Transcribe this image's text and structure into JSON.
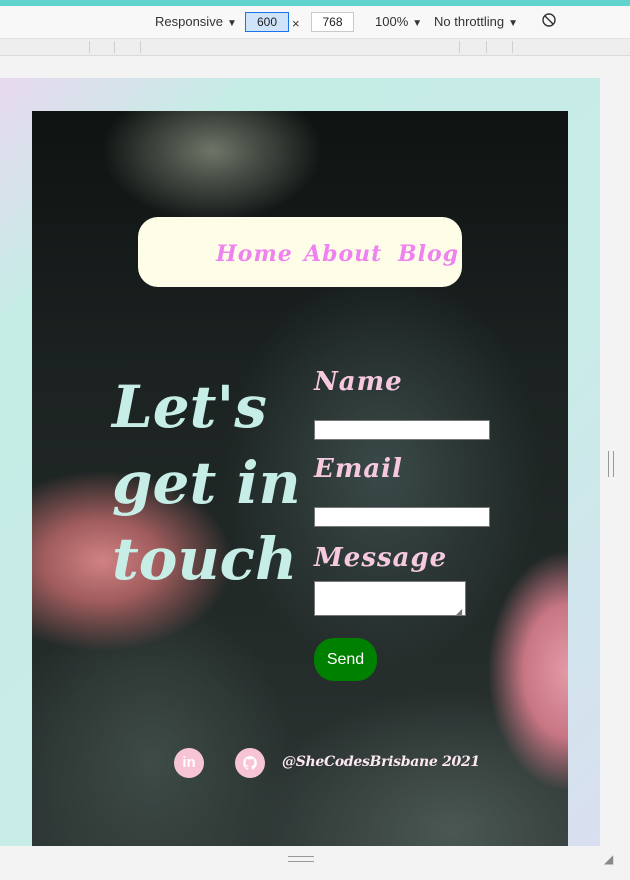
{
  "devtools": {
    "device_mode": "Responsive",
    "width": "600",
    "separator": "×",
    "height": "768",
    "zoom": "100%",
    "throttling": "No throttling",
    "rotate_icon": "rotate-icon"
  },
  "nav": {
    "items": [
      "Home",
      "About",
      "Blog"
    ]
  },
  "hero": {
    "line1": "Let's",
    "line2": "get in",
    "line3": "touch"
  },
  "form": {
    "name_label": "Name",
    "email_label": "Email",
    "message_label": "Message",
    "name_value": "",
    "email_value": "",
    "message_value": "",
    "send_label": "Send"
  },
  "footer": {
    "linkedin_icon": "linkedin-icon",
    "linkedin_glyph": "in",
    "github_icon": "github-icon",
    "handle": "@SheCodesBrisbane 2021"
  },
  "colors": {
    "nav_bg": "#fefee8",
    "nav_link": "#ee82ee",
    "headline": "#c6eee6",
    "labels": "#f6c9de",
    "send_button": "#008000",
    "social_icon_bg": "#f7c4d6"
  }
}
